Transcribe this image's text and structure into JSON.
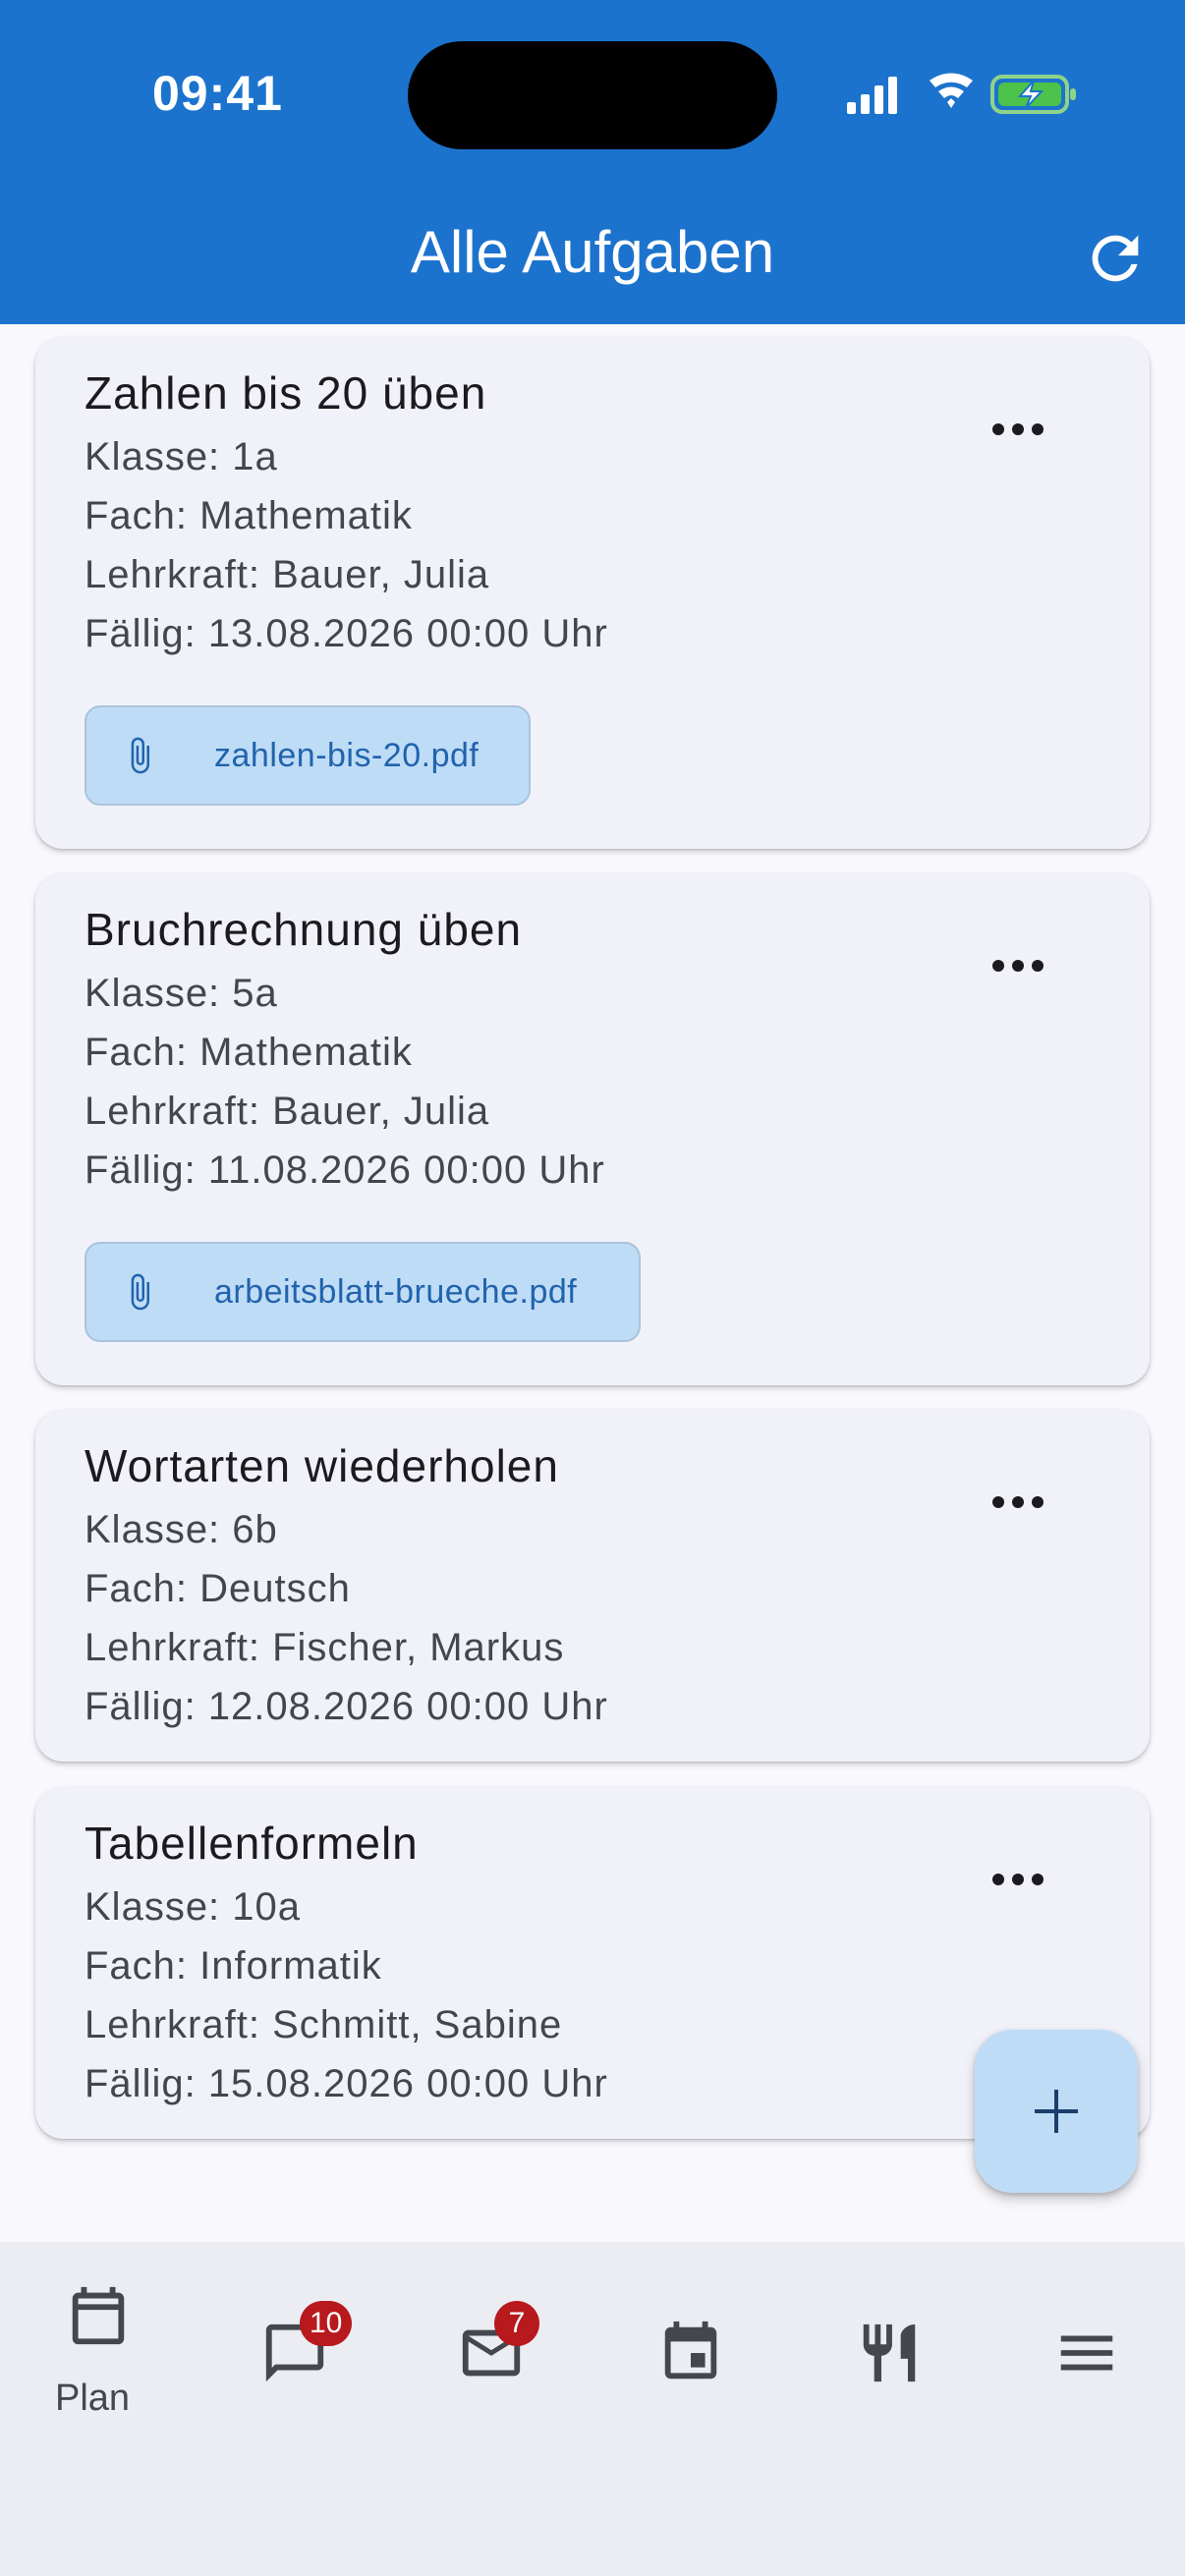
{
  "status_bar": {
    "time": "09:41"
  },
  "app_bar": {
    "title": "Alle Aufgaben"
  },
  "colors": {
    "primary": "#1c73cd",
    "card": "#f1f2f9",
    "attachment": "#bfdcf6",
    "badge": "#b8191c"
  },
  "tasks": [
    {
      "title": "Zahlen bis 20 üben",
      "class": "Klasse: 1a",
      "subject": "Fach: Mathematik",
      "teacher": "Lehrkraft: Bauer, Julia",
      "due": "Fällig: 13.08.2026 00:00 Uhr",
      "attachment": "zahlen-bis-20.pdf"
    },
    {
      "title": "Bruchrechnung üben",
      "class": "Klasse: 5a",
      "subject": "Fach: Mathematik",
      "teacher": "Lehrkraft: Bauer, Julia",
      "due": "Fällig: 11.08.2026 00:00 Uhr",
      "attachment": "arbeitsblatt-brueche.pdf"
    },
    {
      "title": "Wortarten wiederholen",
      "class": "Klasse: 6b",
      "subject": "Fach: Deutsch",
      "teacher": "Lehrkraft: Fischer, Markus",
      "due": "Fällig: 12.08.2026 00:00 Uhr"
    },
    {
      "title": "Tabellenformeln",
      "class": "Klasse: 10a",
      "subject": "Fach: Informatik",
      "teacher": "Lehrkraft: Schmitt, Sabine",
      "due": "Fällig: 15.08.2026 00:00 Uhr"
    }
  ],
  "bottom_nav": {
    "items": [
      {
        "icon": "calendar-icon",
        "label": "Plan"
      },
      {
        "icon": "chat-icon",
        "badge": "10"
      },
      {
        "icon": "mail-icon",
        "badge": "7"
      },
      {
        "icon": "event-icon"
      },
      {
        "icon": "restaurant-icon"
      },
      {
        "icon": "menu-icon"
      }
    ]
  }
}
